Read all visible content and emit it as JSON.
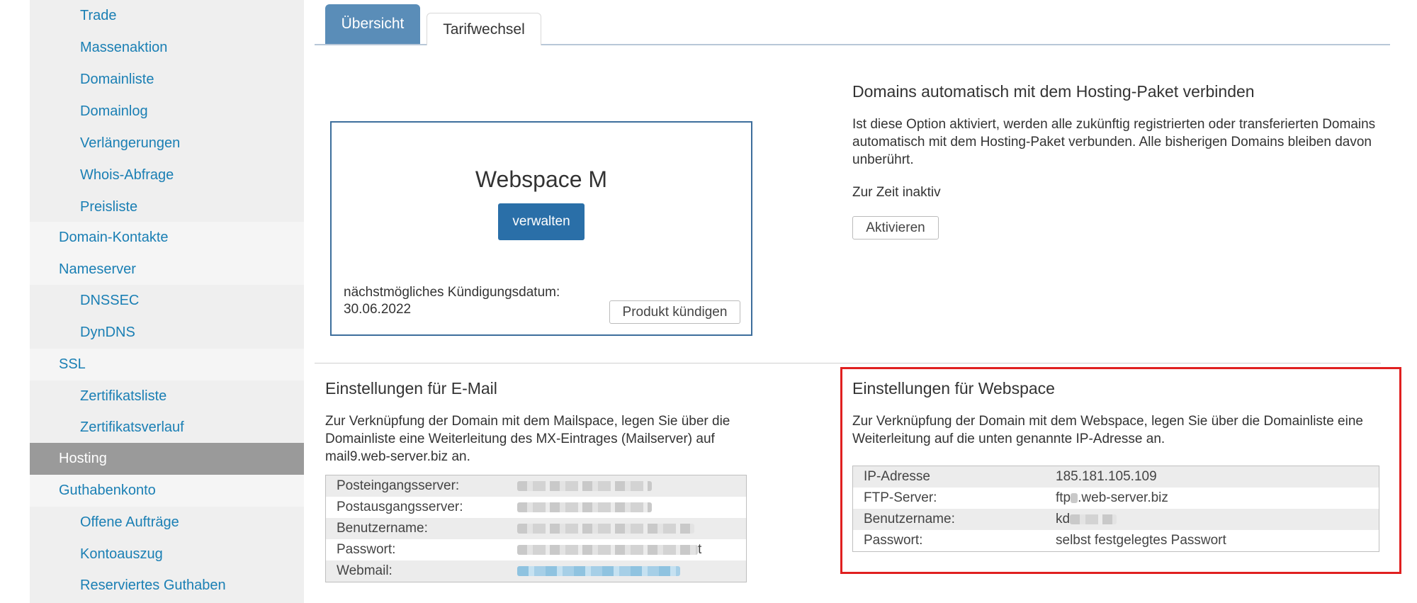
{
  "sidebar": {
    "items": [
      {
        "label": "Trade",
        "level": 2,
        "active": false
      },
      {
        "label": "Massenaktion",
        "level": 2,
        "active": false
      },
      {
        "label": "Domainliste",
        "level": 2,
        "active": false
      },
      {
        "label": "Domainlog",
        "level": 2,
        "active": false
      },
      {
        "label": "Verlängerungen",
        "level": 2,
        "active": false
      },
      {
        "label": "Whois-Abfrage",
        "level": 2,
        "active": false
      },
      {
        "label": "Preisliste",
        "level": 2,
        "active": false
      },
      {
        "label": "Domain-Kontakte",
        "level": 1,
        "active": false
      },
      {
        "label": "Nameserver",
        "level": 1,
        "active": false
      },
      {
        "label": "DNSSEC",
        "level": 2,
        "active": false
      },
      {
        "label": "DynDNS",
        "level": 2,
        "active": false
      },
      {
        "label": "SSL",
        "level": 1,
        "active": false
      },
      {
        "label": "Zertifikatsliste",
        "level": 2,
        "active": false
      },
      {
        "label": "Zertifikatsverlauf",
        "level": 2,
        "active": false
      },
      {
        "label": "Hosting",
        "level": 1,
        "active": true
      },
      {
        "label": "Guthabenkonto",
        "level": 1,
        "active": false
      },
      {
        "label": "Offene Aufträge",
        "level": 2,
        "active": false
      },
      {
        "label": "Kontoauszug",
        "level": 2,
        "active": false
      },
      {
        "label": "Reserviertes Guthaben",
        "level": 2,
        "active": false
      }
    ]
  },
  "tabs": [
    {
      "label": "Übersicht",
      "active": true
    },
    {
      "label": "Tarifwechsel",
      "active": false
    }
  ],
  "product": {
    "name": "Webspace M",
    "manage_label": "verwalten",
    "cancel_date_label": "nächstmögliches Kündigungsdatum:",
    "cancel_date": "30.06.2022",
    "cancel_button": "Produkt kündigen"
  },
  "auto_connect": {
    "title": "Domains automatisch mit dem Hosting-Paket verbinden",
    "description": "Ist diese Option aktiviert, werden alle zukünftig registrierten oder transferierten Domains automatisch mit dem Hosting-Paket verbunden. Alle bisherigen Domains bleiben davon unberührt.",
    "status": "Zur Zeit inaktiv",
    "button": "Aktivieren"
  },
  "email_settings": {
    "title": "Einstellungen für E-Mail",
    "description": "Zur Verknüpfung der Domain mit dem Mailspace, legen Sie über die Domainliste eine Weiterleitung des MX-Eintrages (Mailserver) auf mail9.web-server.biz an.",
    "rows": [
      {
        "key": "Posteingangsserver:",
        "value": ""
      },
      {
        "key": "Postausgangsserver:",
        "value": ""
      },
      {
        "key": "Benutzername:",
        "value": ""
      },
      {
        "key": "Passwort:",
        "value": "t"
      },
      {
        "key": "Webmail:",
        "value": ""
      }
    ]
  },
  "webspace_settings": {
    "title": "Einstellungen für Webspace",
    "description": "Zur Verknüpfung der Domain mit dem Webspace, legen Sie über die Domainliste eine Weiterleitung auf die unten genannte IP-Adresse an.",
    "rows": [
      {
        "key": "IP-Adresse",
        "value": "185.181.105.109"
      },
      {
        "key": "FTP-Server:",
        "value_prefix": "ftp",
        "value_suffix": ".web-server.biz"
      },
      {
        "key": "Benutzername:",
        "value": "kd"
      },
      {
        "key": "Passwort:",
        "value": "selbst festgelegtes Passwort"
      }
    ]
  },
  "colors": {
    "link": "#1a7fb4",
    "active_tab": "#5a8db8",
    "primary_button": "#2a6fa8",
    "highlight": "#e02020"
  }
}
